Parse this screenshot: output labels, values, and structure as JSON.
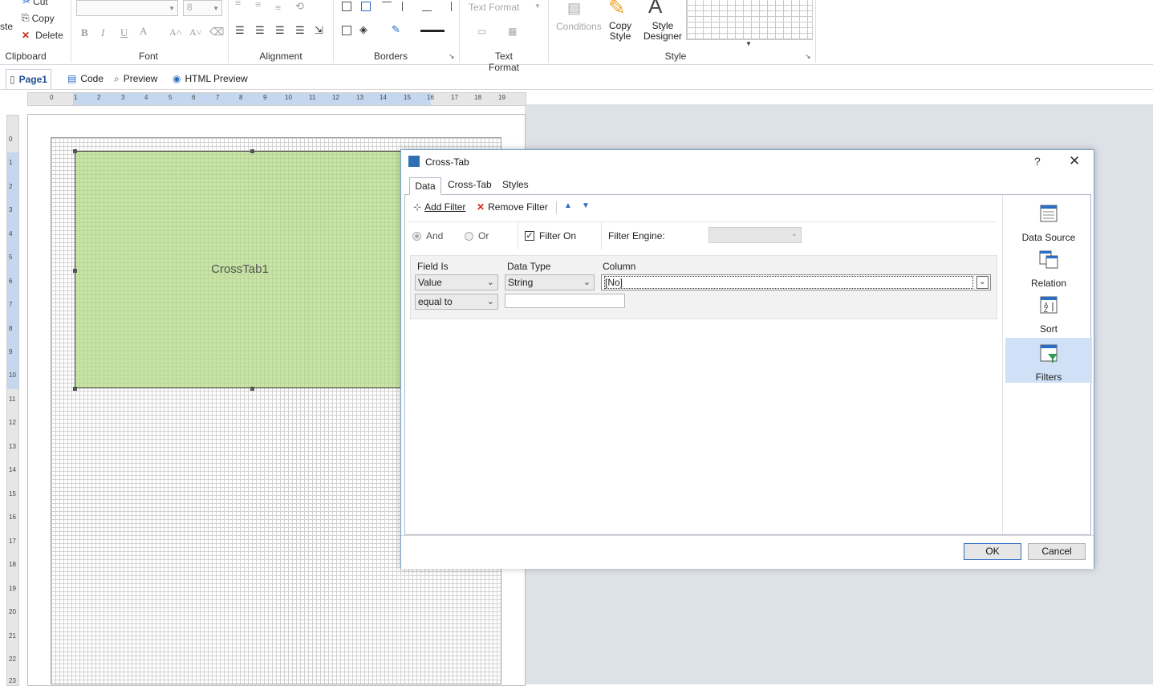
{
  "ribbon": {
    "clipboard": {
      "label": "Clipboard",
      "cut": "Cut",
      "copy": "Copy",
      "delete": "Delete",
      "paste_partial": "ste"
    },
    "font": {
      "label": "Font",
      "size_value": "8"
    },
    "alignment": {
      "label": "Alignment"
    },
    "borders": {
      "label": "Borders"
    },
    "text_format": {
      "label": "Text Format",
      "combo_value": "Text Format"
    },
    "style": {
      "label": "Style",
      "conditions": "Conditions",
      "copy_style": "Copy\nStyle",
      "style_designer": "Style\nDesigner"
    }
  },
  "page_tabs": [
    "Page1",
    "Code",
    "Preview",
    "HTML Preview"
  ],
  "ruler": {
    "h": [
      "0",
      "1",
      "2",
      "3",
      "4",
      "5",
      "6",
      "7",
      "8",
      "9",
      "10",
      "11",
      "12",
      "13",
      "14",
      "15",
      "16",
      "17",
      "18",
      "19"
    ],
    "v": [
      "0",
      "1",
      "2",
      "3",
      "4",
      "5",
      "6",
      "7",
      "8",
      "9",
      "10",
      "11",
      "12",
      "13",
      "14",
      "15",
      "16",
      "17",
      "18",
      "19",
      "20",
      "21",
      "22",
      "23"
    ]
  },
  "canvas": {
    "component_name": "CrossTab1"
  },
  "dialog": {
    "title": "Cross-Tab",
    "help": "?",
    "close": "✕",
    "tabs": [
      "Data",
      "Cross-Tab",
      "Styles"
    ],
    "toolbar": {
      "add_filter": "Add Filter",
      "remove_filter": "Remove Filter"
    },
    "logic": {
      "and": "And",
      "or": "Or",
      "filter_on": "Filter On",
      "filter_engine": "Filter Engine:",
      "selected": "And",
      "filter_on_checked": true
    },
    "filter": {
      "headers": {
        "field_is": "Field Is",
        "data_type": "Data Type",
        "column": "Column"
      },
      "field_is": "Value",
      "data_type": "String",
      "column": "[No]",
      "condition": "equal to",
      "value": ""
    },
    "side_items": [
      "Data Source",
      "Relation",
      "Sort",
      "Filters"
    ],
    "active_side": "Filters",
    "ok": "OK",
    "cancel": "Cancel"
  },
  "colors": {
    "accent": "#2b6cc4",
    "crosstab_fill": "#b3dc8c",
    "selection": "#cfe0f7"
  }
}
